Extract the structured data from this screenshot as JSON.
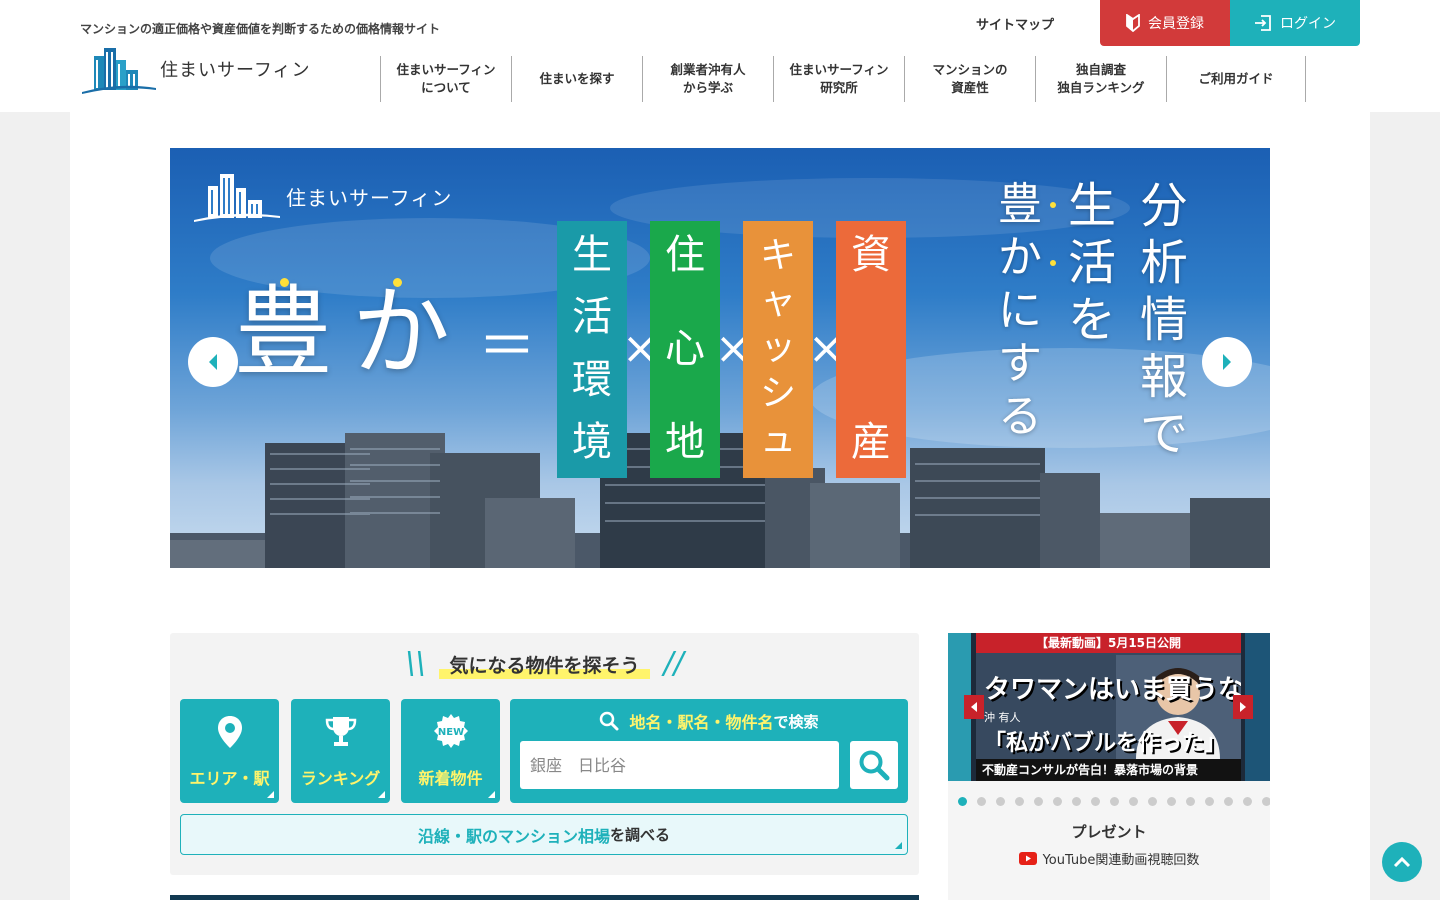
{
  "header": {
    "tagline": "マンションの適正価格や資産価値を判断するための価格情報サイト",
    "logo_text": "住まいサーフィン",
    "sitemap": "サイトマップ",
    "register": "会員登録",
    "login": "ログイン",
    "nav": [
      {
        "label": "住まいサーフィン\nについて"
      },
      {
        "label": "住まいを探す"
      },
      {
        "label": "創業者沖有人\nから学ぶ"
      },
      {
        "label": "住まいサーフィン\n研究所"
      },
      {
        "label": "マンションの\n資産性"
      },
      {
        "label": "独自調査\n独自ランキング"
      },
      {
        "label": "ご利用ガイド"
      }
    ]
  },
  "hero": {
    "logo_text": "住まいサーフィン",
    "yutaka": "豊か",
    "equals": "＝",
    "times": "×",
    "pillars": [
      {
        "chars": [
          "生",
          "活",
          "環",
          "境"
        ],
        "color": "#1a9aa8"
      },
      {
        "chars": [
          "住",
          "心",
          "地"
        ],
        "color": "#1aa84b"
      },
      {
        "chars": [
          "キ",
          "ャ",
          "ッ",
          "シ",
          "ュ"
        ],
        "color": "#e8923a"
      },
      {
        "chars": [
          "資",
          "産"
        ],
        "color": "#ec6a3a"
      }
    ],
    "vertical_cols": [
      {
        "chars": [
          "分",
          "析",
          "情",
          "報",
          "で"
        ]
      },
      {
        "chars": [
          "生",
          "活",
          "を"
        ]
      },
      {
        "chars": [
          "豊",
          "か",
          "に",
          "す",
          "る"
        ]
      }
    ],
    "accent_dot": "#ffe03a"
  },
  "search": {
    "title": "気になる物件を探そう",
    "tiles": [
      {
        "label": "エリア・駅"
      },
      {
        "label": "ランキング"
      },
      {
        "label": "新着物件",
        "badge": "NEW"
      }
    ],
    "keyword_highlight": "地名・駅名・物件名",
    "keyword_suffix": "で検索",
    "input_placeholder": "銀座　日比谷",
    "line_highlight": "沿線・駅のマンション相場",
    "line_suffix": "を調べる"
  },
  "video": {
    "banner": "【最新動画】5月15日公開",
    "headline1": "タワマンはいま買うな",
    "name": "沖 有人",
    "headline2": "「私がバブルを作った」",
    "footer": "不動産コンサルが告白！暴落市場の背景",
    "dot_count": 17,
    "active_dot": 0,
    "present": "プレゼント",
    "yt_label": "YouTube関連動画視聴回数"
  },
  "colors": {
    "accent": "#1eb1ba",
    "register": "#d23a3a",
    "highlight": "#fff46b"
  }
}
